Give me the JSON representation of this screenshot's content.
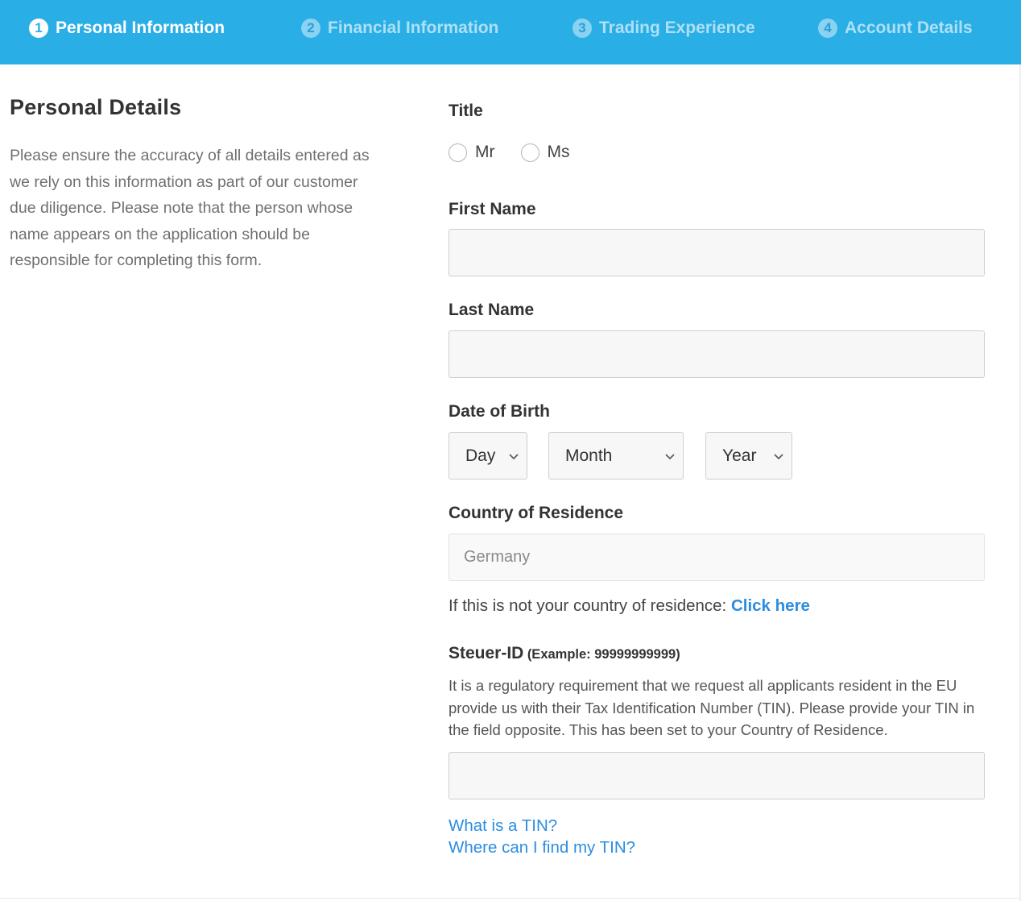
{
  "steps": [
    {
      "num": "1",
      "label": "Personal Information",
      "active": true
    },
    {
      "num": "2",
      "label": "Financial Information",
      "active": false
    },
    {
      "num": "3",
      "label": "Trading Experience",
      "active": false
    },
    {
      "num": "4",
      "label": "Account Details",
      "active": false
    }
  ],
  "colors": {
    "header_bg": "#29aee6",
    "link": "#2c8de0"
  },
  "intro": {
    "heading": "Personal Details",
    "text": "Please ensure the accuracy of all details entered as we rely on this information as part of our customer due diligence. Please note that the person whose name appears on the application should be responsible for completing this form."
  },
  "form": {
    "title_label": "Title",
    "title_options": [
      "Mr",
      "Ms"
    ],
    "first_name_label": "First Name",
    "first_name_value": "",
    "last_name_label": "Last Name",
    "last_name_value": "",
    "dob_label": "Date of Birth",
    "dob_day": "Day",
    "dob_month": "Month",
    "dob_year": "Year",
    "country_label": "Country of Residence",
    "country_value": "Germany",
    "country_note": "If this is not your country of residence:",
    "country_link": "Click here",
    "tin_label": "Steuer-ID",
    "tin_example": "(Example: 99999999999)",
    "tin_description": "It is a regulatory requirement that we request all applicants resident in the EU provide us with their Tax Identification Number (TIN). Please provide your TIN in the field opposite. This has been set to your Country of Residence.",
    "tin_value": "",
    "link_what_tin": "What is a TIN?",
    "link_find_tin": "Where can I find my TIN?"
  },
  "icons": {
    "select_arrow": "chevron-down-icon",
    "radio": "radio-button-icon"
  }
}
